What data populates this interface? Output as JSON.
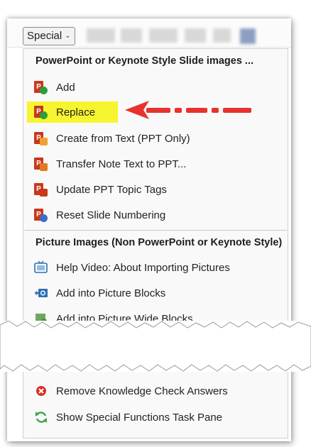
{
  "toolbar": {
    "special_label": "Special"
  },
  "menu": {
    "section1_title": "PowerPoint or Keynote Style Slide images ...",
    "section1_items": [
      {
        "label": "Add",
        "icon": "ppt-add-icon"
      },
      {
        "label": "Replace",
        "icon": "ppt-replace-icon"
      },
      {
        "label": "Create from Text (PPT Only)",
        "icon": "ppt-create-icon"
      },
      {
        "label": "Transfer Note Text to PPT...",
        "icon": "ppt-transfer-icon"
      },
      {
        "label": "Update PPT Topic Tags",
        "icon": "ppt-tags-icon"
      },
      {
        "label": "Reset Slide Numbering",
        "icon": "ppt-reset-icon"
      }
    ],
    "section2_title": "Picture Images (Non PowerPoint or Keynote Style)",
    "section2_items": [
      {
        "label": "Help Video: About Importing Pictures",
        "icon": "help-video-icon"
      },
      {
        "label": "Add into Picture Blocks",
        "icon": "picture-blocks-icon"
      },
      {
        "label": "Add into Picture Wide Blocks",
        "icon": "picture-wide-icon"
      }
    ],
    "bottom_items": [
      {
        "label": "Remove Knowledge Check Answers",
        "icon": "remove-icon"
      },
      {
        "label": "Show Special Functions Task Pane",
        "icon": "refresh-icon"
      }
    ]
  },
  "colors": {
    "highlight": "#f6f52f",
    "arrow": "#e8322d",
    "ppt": "#c9381c"
  }
}
